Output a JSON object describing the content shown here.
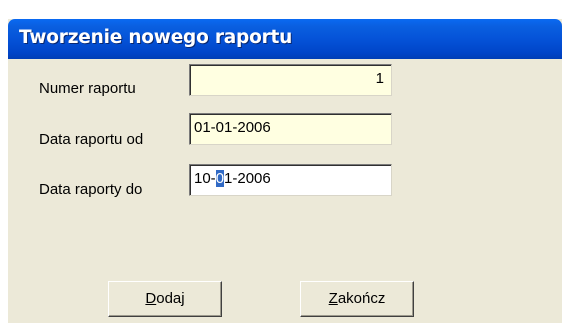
{
  "window": {
    "title": "Tworzenie nowego raportu"
  },
  "form": {
    "report_number": {
      "label": "Numer raportu",
      "value": "1"
    },
    "date_from": {
      "label": "Data raportu od",
      "value": "01-01-2006"
    },
    "date_to": {
      "label": "Data raporty do",
      "value_before": "10-",
      "value_selected": "0",
      "value_after": "1-2006"
    }
  },
  "buttons": {
    "add": {
      "accel": "D",
      "rest": "odaj"
    },
    "close": {
      "accel": "Z",
      "rest": "akończ"
    }
  },
  "colors": {
    "titlebar": "#0553d8",
    "window_bg": "#ece9d8",
    "readonly_field_bg": "#ffffe1",
    "editable_field_bg": "#ffffff",
    "selection": "#316ac5"
  }
}
